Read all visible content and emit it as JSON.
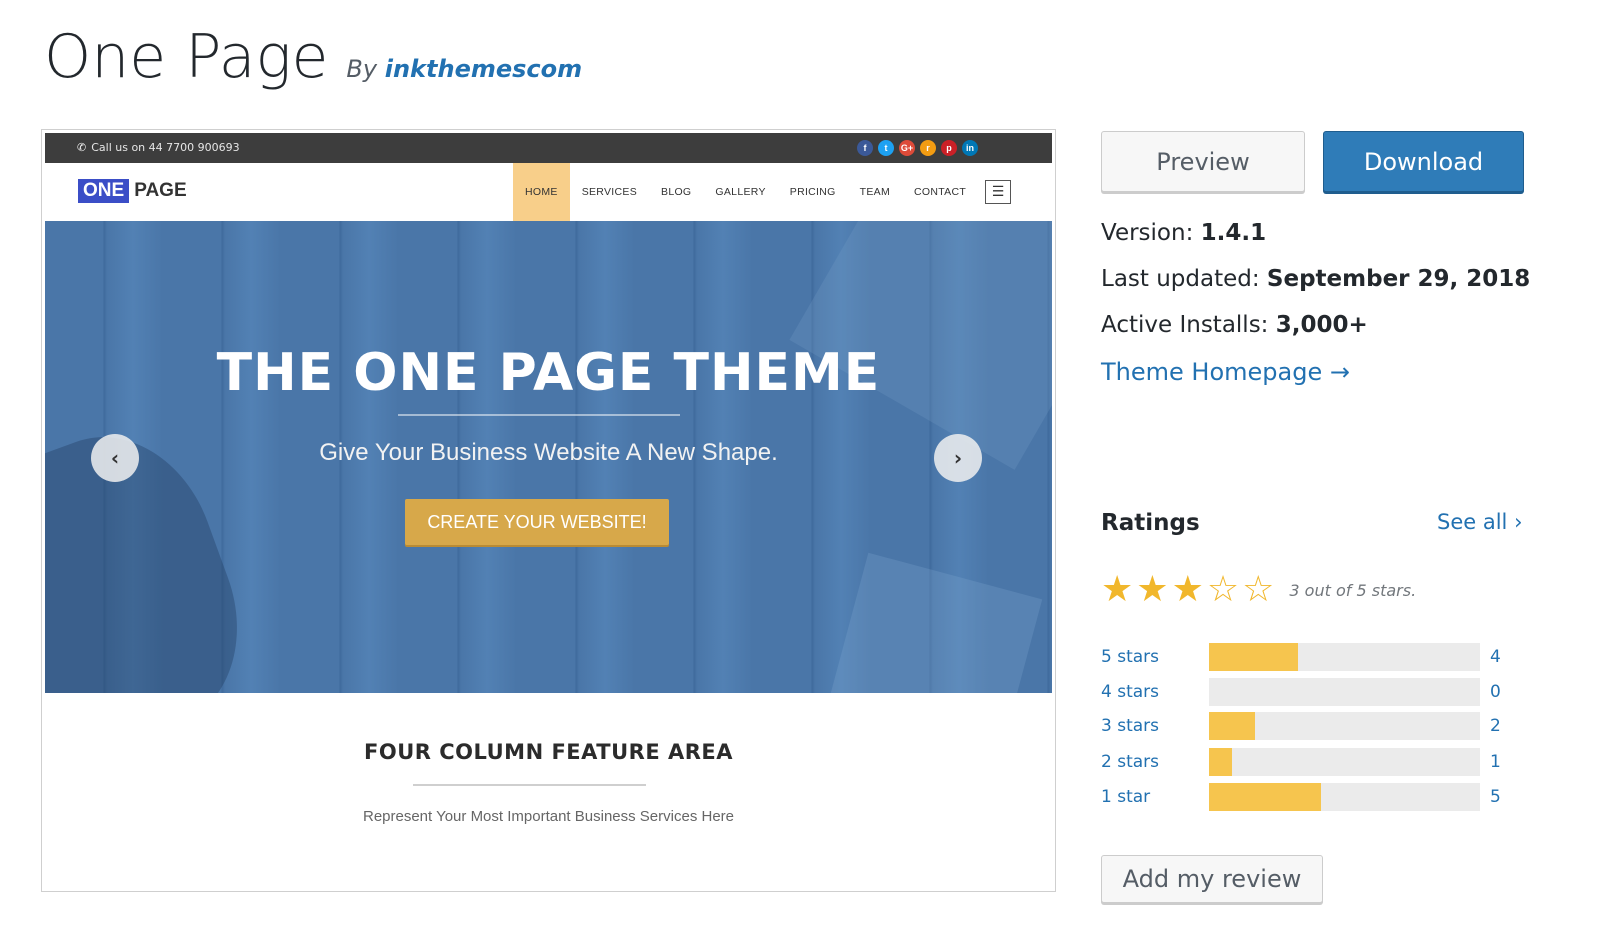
{
  "theme": {
    "title": "One Page",
    "by_prefix": "By",
    "author": "inkthemescom"
  },
  "screenshot": {
    "phone_text": "Call us on 44 7700 900693",
    "phone_icon": "phone-icon",
    "socials": [
      {
        "icon": "facebook-icon",
        "glyph": "f",
        "color": "#3b5998"
      },
      {
        "icon": "twitter-icon",
        "glyph": "t",
        "color": "#1da1f2"
      },
      {
        "icon": "google-plus-icon",
        "glyph": "G+",
        "color": "#dd4b39"
      },
      {
        "icon": "rss-icon",
        "glyph": "r",
        "color": "#f39c12"
      },
      {
        "icon": "pinterest-icon",
        "glyph": "p",
        "color": "#cb2027"
      },
      {
        "icon": "linkedin-icon",
        "glyph": "in",
        "color": "#0077b5"
      }
    ],
    "logo_box": "ONE",
    "logo_text": "PAGE",
    "nav": [
      "HOME",
      "SERVICES",
      "BLOG",
      "GALLERY",
      "PRICING",
      "TEAM",
      "CONTACT"
    ],
    "nav_active": "HOME",
    "hero_title": "THE ONE PAGE THEME",
    "hero_subtitle": "Give Your Business Website A New Shape.",
    "hero_cta": "CREATE YOUR WEBSITE!",
    "feature_title": "FOUR COLUMN FEATURE AREA",
    "feature_subtitle": "Represent Your Most Important Business Services Here"
  },
  "actions": {
    "preview_label": "Preview",
    "download_label": "Download"
  },
  "meta": {
    "version_label": "Version:",
    "version": "1.4.1",
    "updated_label": "Last updated:",
    "updated": "September 29, 2018",
    "installs_label": "Active Installs:",
    "installs": "3,000+",
    "homepage_link": "Theme Homepage →"
  },
  "ratings": {
    "heading": "Ratings",
    "see_all": "See all",
    "average": 3,
    "max": 5,
    "summary": "3 out of 5 stars.",
    "rows": [
      {
        "label": "5 stars",
        "count": "4",
        "fraction": 0.33
      },
      {
        "label": "4 stars",
        "count": "0",
        "fraction": 0.0
      },
      {
        "label": "3 stars",
        "count": "2",
        "fraction": 0.17
      },
      {
        "label": "2 stars",
        "count": "1",
        "fraction": 0.085
      },
      {
        "label": "1 star",
        "count": "5",
        "fraction": 0.415
      }
    ],
    "add_review": "Add my review"
  },
  "colors": {
    "link": "#2271b1",
    "download_button": "#2f7cb8",
    "star": "#f1b72c",
    "bar_fill": "#f6c54e",
    "hero_cta": "#d7a84a",
    "nav_active": "#f8cf8a"
  }
}
